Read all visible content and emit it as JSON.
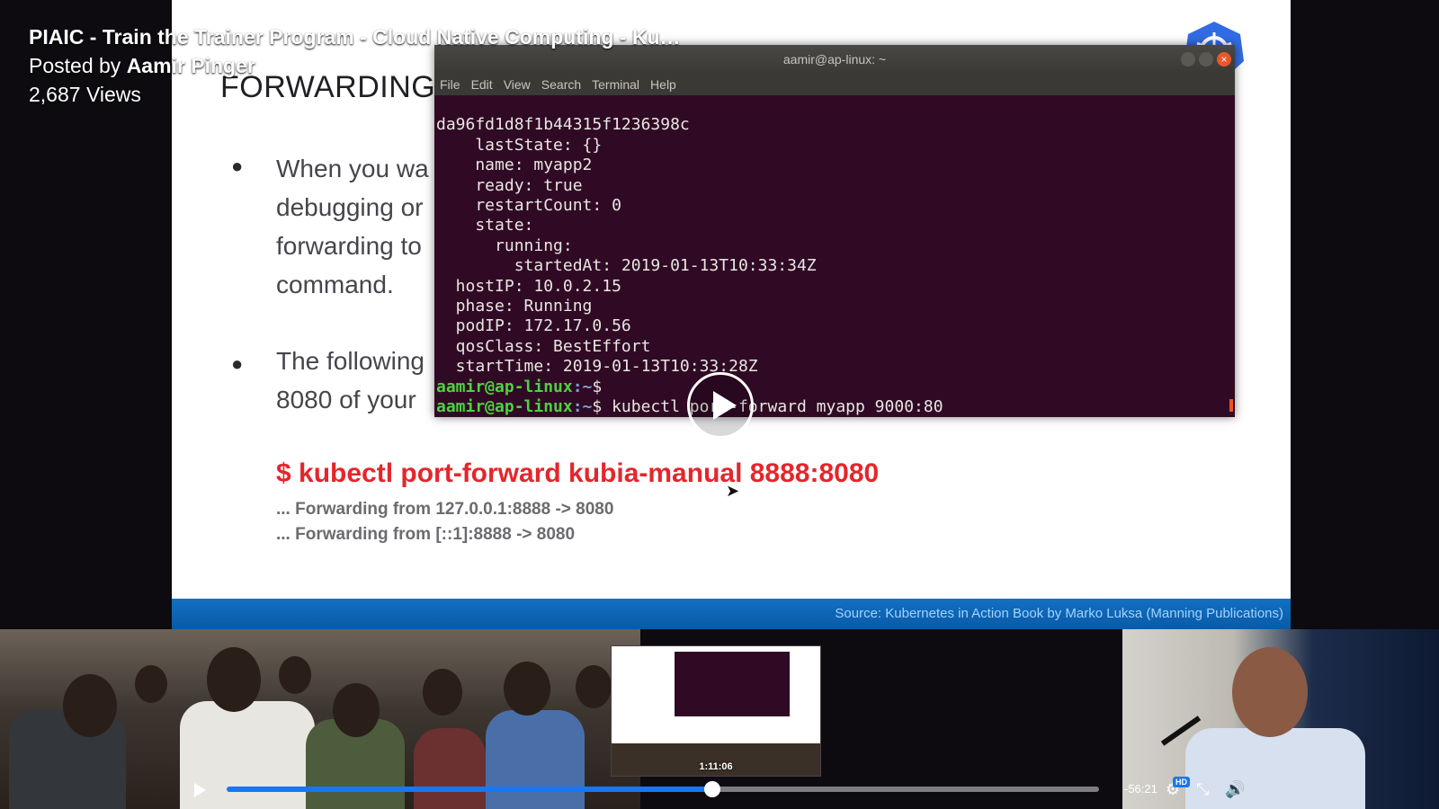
{
  "video": {
    "title": "PIAIC - Train the Trainer Program - Cloud Native Computing - Ku…",
    "posted_prefix": "Posted by",
    "author": "Aamir Pinger",
    "views": "2,687 Views"
  },
  "slide": {
    "title": "FORWARDING",
    "bullets": [
      [
        "When you wa",
        "debugging or",
        "forwarding to",
        "command."
      ],
      [
        "The following",
        "8080 of your"
      ]
    ],
    "command": "$ kubectl port-forward kubia-manual 8888:8080",
    "forward_lines": [
      "... Forwarding from 127.0.0.1:8888 -> 8080",
      "... Forwarding from [::1]:8888 -> 8080"
    ],
    "footer": "Source: Kubernetes in Action Book by Marko Luksa (Manning Publications)"
  },
  "terminal": {
    "title": "aamir@ap-linux: ~",
    "menu": [
      "File",
      "Edit",
      "View",
      "Search",
      "Terminal",
      "Help"
    ],
    "output": [
      "da96fd1d8f1b44315f1236398c",
      "    lastState: {}",
      "    name: myapp2",
      "    ready: true",
      "    restartCount: 0",
      "    state:",
      "      running:",
      "        startedAt: 2019-01-13T10:33:34Z",
      "  hostIP: 10.0.2.15",
      "  phase: Running",
      "  podIP: 172.17.0.56",
      "  qosClass: BestEffort",
      "  startTime: 2019-01-13T10:33:28Z"
    ],
    "prompt_user": "aamir@ap-linux",
    "prompt_path": ":~",
    "prompt_symbol": "$",
    "last_command": " kubectl port-forward myapp 9000:80"
  },
  "player": {
    "progress": 0.557,
    "thumbnail_time": "1:11:06",
    "remaining": "-56:21",
    "hd_badge": "HD",
    "accent_color": "#1877f2",
    "icons": [
      "play-icon",
      "settings-icon",
      "exit-fullscreen-icon",
      "volume-icon"
    ]
  }
}
